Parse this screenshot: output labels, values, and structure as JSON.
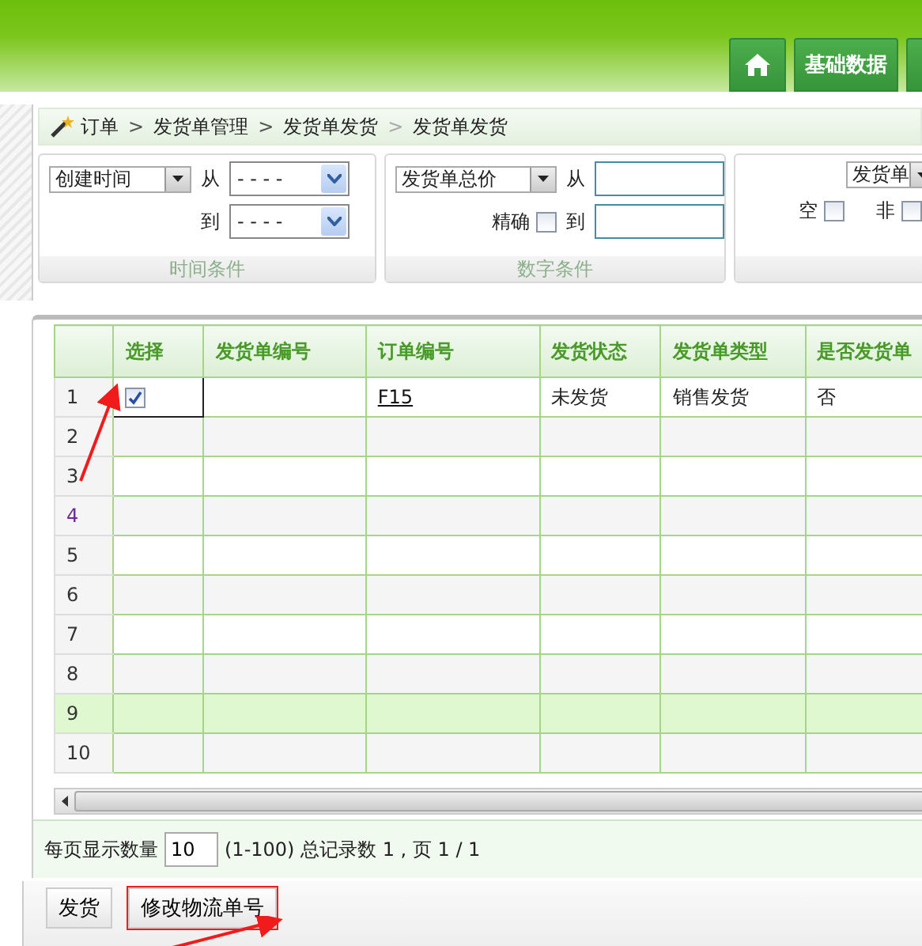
{
  "header": {
    "nav": [
      {
        "kind": "home"
      },
      {
        "kind": "text",
        "label": "基础数据"
      },
      {
        "kind": "partial"
      }
    ]
  },
  "breadcrumb": [
    {
      "label": "订单"
    },
    {
      "sep": ">",
      "label": "发货单管理"
    },
    {
      "sep": ">",
      "label": "发货单发货"
    },
    {
      "sep": ">",
      "label": "发货单发货"
    }
  ],
  "filters": [
    {
      "kind": "time",
      "field": "创建时间",
      "from_label": "从",
      "from_value": "- - - -",
      "to_label": "到",
      "to_value": "- - - -",
      "caption": "时间条件"
    },
    {
      "kind": "number",
      "field": "发货单总价",
      "from_label": "从",
      "exact_label": "精确",
      "exact_checked": false,
      "to_label": "到",
      "caption": "数字条件"
    },
    {
      "kind": "text",
      "field": "发货单",
      "empty_label": "空",
      "empty_checked": false,
      "not_label": "非",
      "not_checked": false
    }
  ],
  "table": {
    "columns": [
      "选择",
      "发货单编号",
      "订单编号",
      "发货状态",
      "发货单类型",
      "是否发货单"
    ],
    "rows": [
      {
        "number": "1",
        "checked": true,
        "marked": true,
        "highlighted": false,
        "order_no": "F15",
        "status": "未发货",
        "type": "销售发货",
        "is_shipping": "否"
      },
      {
        "number": "2",
        "marked": false,
        "highlighted": false
      },
      {
        "number": "3",
        "marked": false,
        "highlighted": false
      },
      {
        "number": "4",
        "marked": false,
        "highlighted": false
      },
      {
        "number": "5",
        "marked": false,
        "highlighted": false
      },
      {
        "number": "6",
        "marked": false,
        "highlighted": false
      },
      {
        "number": "7",
        "marked": false,
        "highlighted": false
      },
      {
        "number": "8",
        "marked": false,
        "highlighted": false
      },
      {
        "number": "9",
        "marked": false,
        "highlighted": true
      },
      {
        "number": "10",
        "marked": false,
        "highlighted": false
      }
    ]
  },
  "pager": {
    "label": "每页显示数量",
    "value": "10",
    "info": "(1-100) 总记录数 1 , 页 1 / 1"
  },
  "buttons": [
    {
      "label": "发货",
      "marked": false
    },
    {
      "label": "修改物流单号",
      "marked": true
    }
  ]
}
